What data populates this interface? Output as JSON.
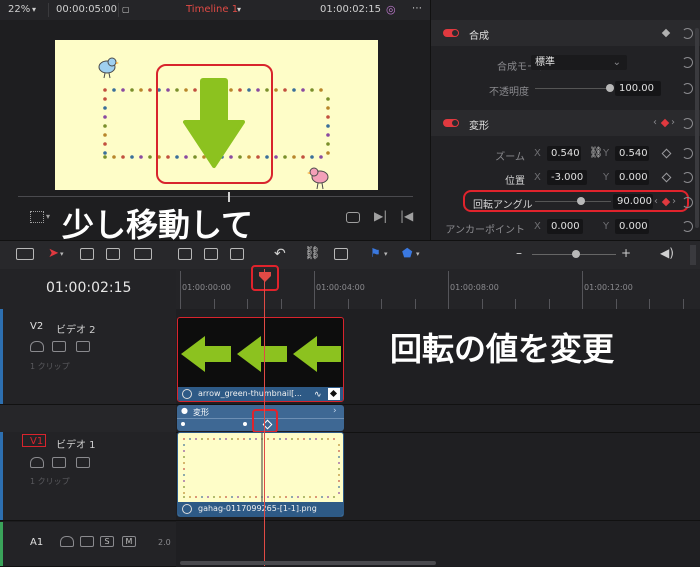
{
  "viewer": {
    "zoom": "22%",
    "source_timecode": "00:00:05:00",
    "timeline_name": "Timeline 1",
    "current_timecode": "01:00:02:15"
  },
  "inspector": {
    "composite": {
      "title": "合成",
      "mode_label": "合成モード",
      "mode_value": "標準",
      "opacity_label": "不透明度",
      "opacity_value": "100.00"
    },
    "transform": {
      "title": "変形",
      "zoom_label": "ズーム",
      "zoom_x": "0.540",
      "zoom_y": "0.540",
      "position_label": "位置",
      "position_x": "-3.000",
      "position_y": "0.000",
      "rotation_label": "回転アングル",
      "rotation_value": "90.000",
      "anchor_label": "アンカーポイント",
      "anchor_x": "0.000",
      "anchor_y": "0.000",
      "axis_x": "X",
      "axis_y": "Y"
    }
  },
  "timeline": {
    "timecode": "01:00:02:15",
    "ruler_labels": [
      "01:00:00:00",
      "01:00:04:00",
      "01:00:08:00",
      "01:00:12:00"
    ],
    "tracks": [
      {
        "id": "V2",
        "name": "ビデオ 2",
        "clip_count": "1 クリップ"
      },
      {
        "id": "V1",
        "name": "ビデオ 1",
        "clip_count": "1 クリップ"
      },
      {
        "id": "A1",
        "name": "",
        "level": "2.0"
      }
    ],
    "clips": {
      "v2": "arrow_green-thumbnail[...",
      "v1": "gahag-0117099265-[1-1].png",
      "keyframe_track": "変形"
    },
    "audio_buttons": {
      "solo": "S",
      "mute": "M"
    }
  },
  "annotations": {
    "move_a_bit": "少し移動して",
    "change_rotation": "回転の値を変更"
  },
  "colors": {
    "accent_red": "#e0232c",
    "clip_blue": "#2e5a86",
    "arrow_green": "#8cc21f",
    "frame_bg": "#fefdc8"
  }
}
